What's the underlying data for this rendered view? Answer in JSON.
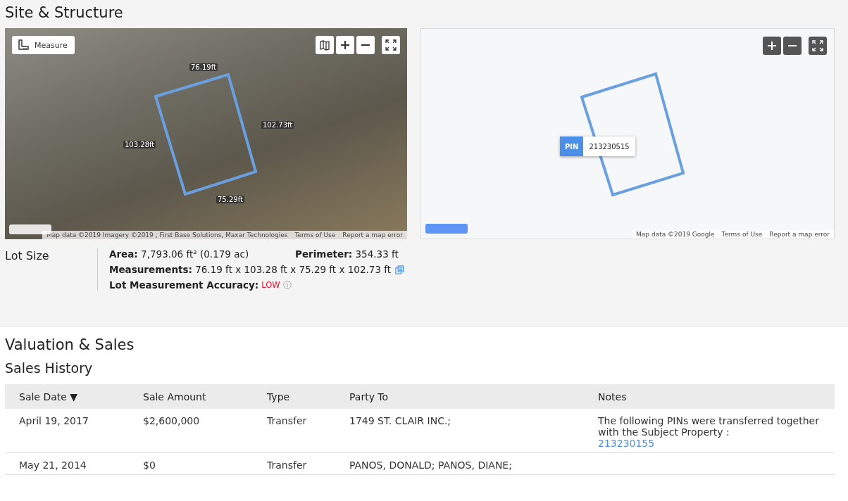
{
  "site": {
    "title": "Site & Structure",
    "satellite_map": {
      "measure_button": "Measure",
      "edge_labels": [
        "76.19ft",
        "102.73ft",
        "75.29ft",
        "103.28ft"
      ],
      "attribution": "Map data ©2019 Imagery ©2019 , First Base Solutions, Maxar Technologies",
      "terms": "Terms of Use",
      "report": "Report a map error"
    },
    "road_map": {
      "pin_label": "PIN",
      "pin_value": "213230515",
      "attribution": "Map data ©2019 Google",
      "terms": "Terms of Use",
      "report": "Report a map error"
    },
    "lot_size": {
      "heading": "Lot Size",
      "area_label": "Area:",
      "area_value": "7,793.06 ft² (0.179 ac)",
      "perimeter_label": "Perimeter:",
      "perimeter_value": "354.33 ft",
      "measurements_label": "Measurements:",
      "measurements_value": "76.19 ft x 103.28 ft x 75.29 ft x 102.73 ft",
      "accuracy_label": "Lot Measurement Accuracy:",
      "accuracy_value": "LOW"
    }
  },
  "valuation": {
    "title": "Valuation & Sales",
    "subtitle": "Sales History",
    "table": {
      "columns": [
        {
          "label": "Sale Date ▼"
        },
        {
          "label": "Sale Amount"
        },
        {
          "label": "Type"
        },
        {
          "label": "Party To"
        },
        {
          "label": "Notes"
        }
      ],
      "rows": [
        {
          "cells": [
            "April 19, 2017",
            "$2,600,000",
            "Transfer",
            "1749 ST. CLAIR INC.;"
          ],
          "notes": "The following PINs were transferred together with the Subject Property :",
          "note_link": "213230155"
        },
        {
          "cells": [
            "May 21, 2014",
            "$0",
            "Transfer",
            "PANOS, DONALD; PANOS, DIANE;"
          ],
          "notes": "",
          "note_link": ""
        }
      ]
    }
  }
}
